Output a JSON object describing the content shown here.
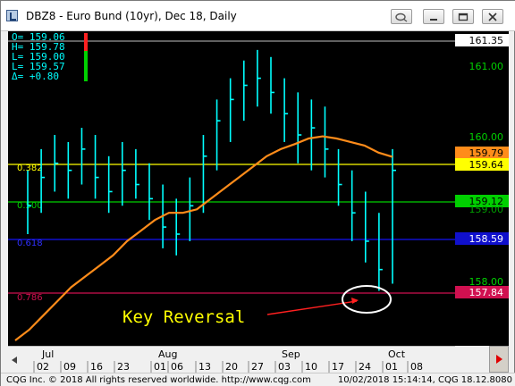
{
  "window": {
    "title": "DBZ8 - Euro Bund (10yr), Dec 18, Daily"
  },
  "ohlc": {
    "open": "O=  159.06",
    "high": "H=  159.78",
    "low1": "L=  159.00",
    "low2": "L=  159.57",
    "delta": "Δ=   +0.80"
  },
  "price_labels": {
    "top_line": "161.35",
    "p161": "161.00",
    "p160": "160.00",
    "ma": "159.79",
    "yellow": "159.64",
    "green": "159.12",
    "p159": "159.00",
    "blue": "158.59",
    "p158": "158.00",
    "red": "157.84"
  },
  "fib_labels": {
    "f382": "0.382",
    "f500": "0.500",
    "f618": "0.618",
    "f786": "0.786"
  },
  "annotation": {
    "text": "Key Reversal"
  },
  "x_axis": {
    "months": [
      "Jul",
      "Aug",
      "Sep",
      "Oct"
    ],
    "days": [
      "02",
      "09",
      "16",
      "23",
      "01",
      "06",
      "13",
      "20",
      "27",
      "03",
      "10",
      "17",
      "24",
      "01",
      "08"
    ]
  },
  "colors": {
    "background": "#000000",
    "bars": "#00ffff",
    "moving_average": "#ff8c1a",
    "fib_382": "#ffff00",
    "fib_500": "#00d000",
    "fib_618": "#1010cc",
    "fib_786": "#d01050",
    "top_line": "#c0c0c0",
    "ma_label_bg": "#ff8c1a",
    "yellow_label_bg": "#ffff00",
    "green_label_bg": "#00d000",
    "blue_label_bg": "#1010cc",
    "red_label_bg": "#d01050"
  },
  "status": {
    "left": "CQG Inc. © 2018 All rights reserved worldwide. http://www.cqg.com",
    "right": "10/02/2018 15:14:14, CQG 18.12.8080"
  },
  "icons": [
    "app-chart-icon",
    "pin-icon",
    "minimize-icon",
    "maximize-icon",
    "close-icon",
    "scroll-left-icon",
    "scroll-right-icon"
  ],
  "chart_data": {
    "type": "ohlc",
    "title": "DBZ8 - Euro Bund (10yr), Dec 18, Daily",
    "ylim": [
      157.25,
      161.5
    ],
    "horizontal_lines": [
      {
        "name": "0.382",
        "value": 159.64
      },
      {
        "name": "0.500",
        "value": 159.12
      },
      {
        "name": "0.618",
        "value": 158.59
      },
      {
        "name": "0.786",
        "value": 157.84
      },
      {
        "name": "top",
        "value": 161.35
      }
    ],
    "ma_values": [
      157.2,
      157.35,
      157.55,
      157.75,
      157.95,
      158.1,
      158.25,
      158.4,
      158.6,
      158.75,
      158.9,
      159.0,
      159.0,
      159.05,
      159.2,
      159.35,
      159.5,
      159.65,
      159.8,
      159.9,
      159.97,
      160.05,
      160.08,
      160.05,
      160.0,
      159.95,
      159.85,
      159.79
    ],
    "bars": [
      {
        "h": 159.6,
        "l": 158.7,
        "c": 159.1
      },
      {
        "h": 159.9,
        "l": 159.0,
        "c": 159.5
      },
      {
        "h": 160.1,
        "l": 159.3,
        "c": 159.7
      },
      {
        "h": 160.0,
        "l": 159.2,
        "c": 159.6
      },
      {
        "h": 160.2,
        "l": 159.4,
        "c": 159.9
      },
      {
        "h": 160.1,
        "l": 159.2,
        "c": 159.5
      },
      {
        "h": 159.8,
        "l": 159.0,
        "c": 159.3
      },
      {
        "h": 160.0,
        "l": 159.1,
        "c": 159.6
      },
      {
        "h": 159.9,
        "l": 159.2,
        "c": 159.4
      },
      {
        "h": 159.7,
        "l": 158.9,
        "c": 159.2
      },
      {
        "h": 159.4,
        "l": 158.5,
        "c": 158.8
      },
      {
        "h": 159.2,
        "l": 158.4,
        "c": 158.7
      },
      {
        "h": 159.5,
        "l": 158.6,
        "c": 159.1
      },
      {
        "h": 160.1,
        "l": 159.0,
        "c": 159.8
      },
      {
        "h": 160.6,
        "l": 159.6,
        "c": 160.3
      },
      {
        "h": 160.9,
        "l": 160.0,
        "c": 160.6
      },
      {
        "h": 161.15,
        "l": 160.3,
        "c": 160.8
      },
      {
        "h": 161.3,
        "l": 160.5,
        "c": 160.9
      },
      {
        "h": 161.2,
        "l": 160.4,
        "c": 160.7
      },
      {
        "h": 160.9,
        "l": 160.0,
        "c": 160.4
      },
      {
        "h": 160.7,
        "l": 159.7,
        "c": 160.1
      },
      {
        "h": 160.6,
        "l": 159.6,
        "c": 160.2
      },
      {
        "h": 160.5,
        "l": 159.5,
        "c": 159.9
      },
      {
        "h": 159.9,
        "l": 159.1,
        "c": 159.4
      },
      {
        "h": 159.6,
        "l": 158.6,
        "c": 159.0
      },
      {
        "h": 159.3,
        "l": 158.3,
        "c": 158.6
      },
      {
        "h": 159.0,
        "l": 157.9,
        "c": 158.2
      },
      {
        "h": 159.9,
        "l": 158.0,
        "c": 159.6
      }
    ]
  }
}
